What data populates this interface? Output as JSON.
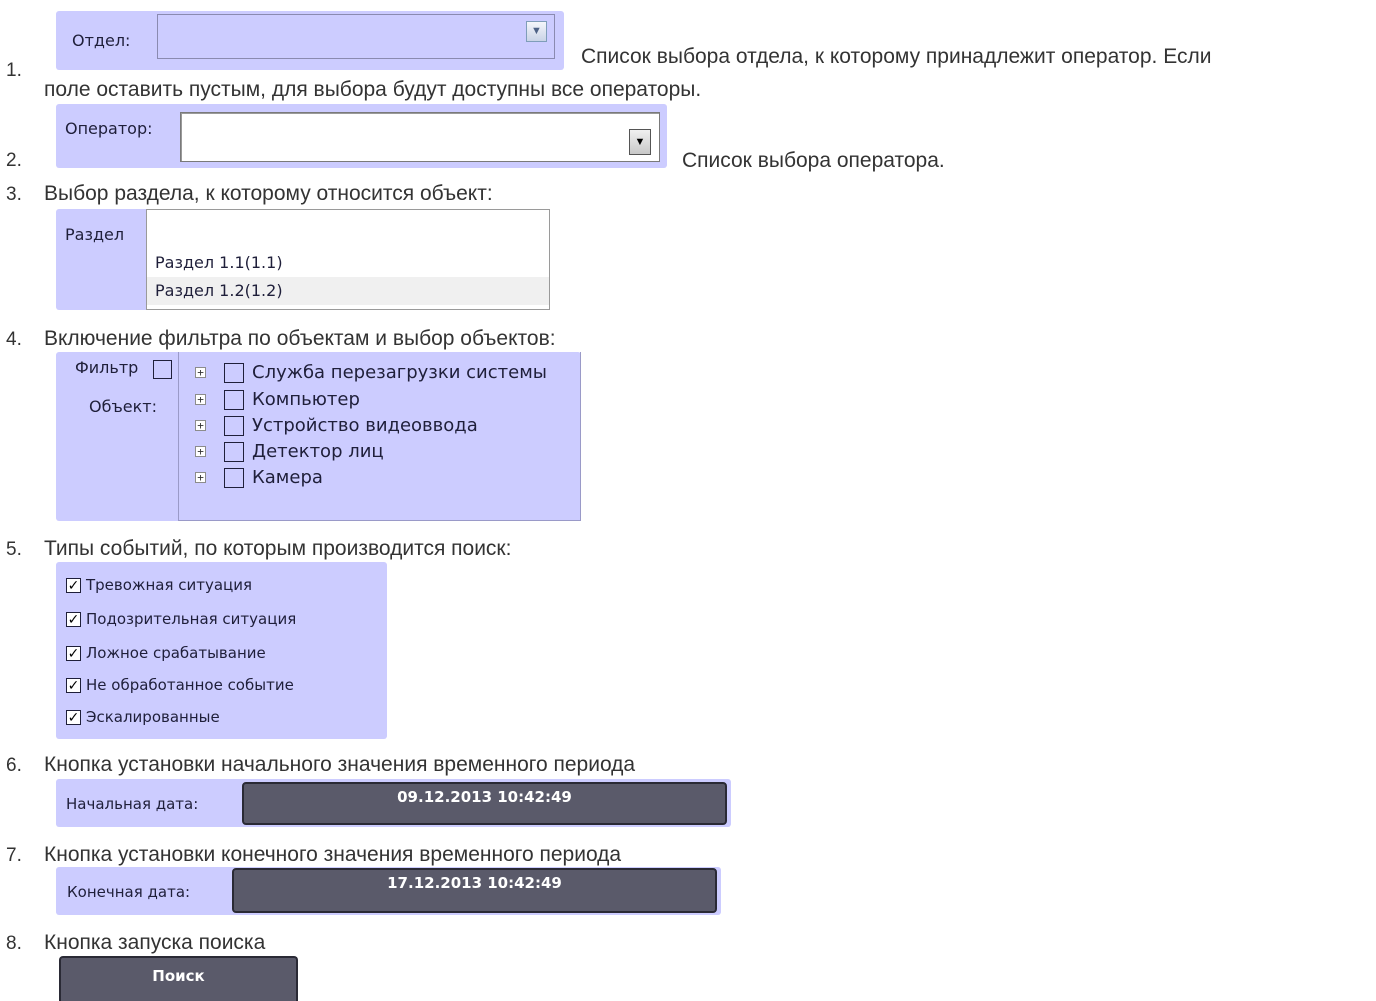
{
  "items": {
    "i1": {
      "num": "1.",
      "ui_label": "Отдел:",
      "value": "",
      "text_a": "Список выбора отдела, к которому принадлежит оператор. Если",
      "text_b": "поле оставить пустым, для выбора будут доступны все операторы."
    },
    "i2": {
      "num": "2.",
      "ui_label": "Оператор:",
      "value": "",
      "text": "Список выбора оператора."
    },
    "i3": {
      "num": "3.",
      "text": "Выбор раздела, к которому относится объект:",
      "ui_label": "Раздел",
      "options": [
        "Раздел 1.1(1.1)",
        "Раздел 1.2(1.2)"
      ]
    },
    "i4": {
      "num": "4.",
      "text": "Включение фильтра по объектам и выбор объектов:",
      "filter_label": "Фильтр",
      "object_label": "Объект:",
      "objects": [
        "Служба перезагрузки системы",
        "Компьютер",
        "Устройство видеоввода",
        "Детектор лиц",
        "Камера"
      ]
    },
    "i5": {
      "num": "5.",
      "text": "Типы событий, по которым производится поиск:",
      "events": [
        "Тревожная ситуация",
        "Подозрительная ситуация",
        "Ложное срабатывание",
        "Не обработанное событие",
        "Эскалированные"
      ]
    },
    "i6": {
      "num": "6.",
      "text": "Кнопка установки начального значения временного периода",
      "ui_label": "Начальная дата:",
      "value": "09.12.2013 10:42:49"
    },
    "i7": {
      "num": "7.",
      "text": "Кнопка установки конечного значения временного периода",
      "ui_label": "Конечная дата:",
      "value": "17.12.2013 10:42:49"
    },
    "i8": {
      "num": "8.",
      "text": "Кнопка запуска поиска",
      "button_label": "Поиск"
    }
  },
  "colors": {
    "panel": "#ccccff",
    "dark_button": "#5a5a6a",
    "text": "#333333"
  },
  "icons": {
    "dropdown": "chevron-down-icon",
    "expander": "plus-expander-icon",
    "checkmark": "check-icon"
  }
}
